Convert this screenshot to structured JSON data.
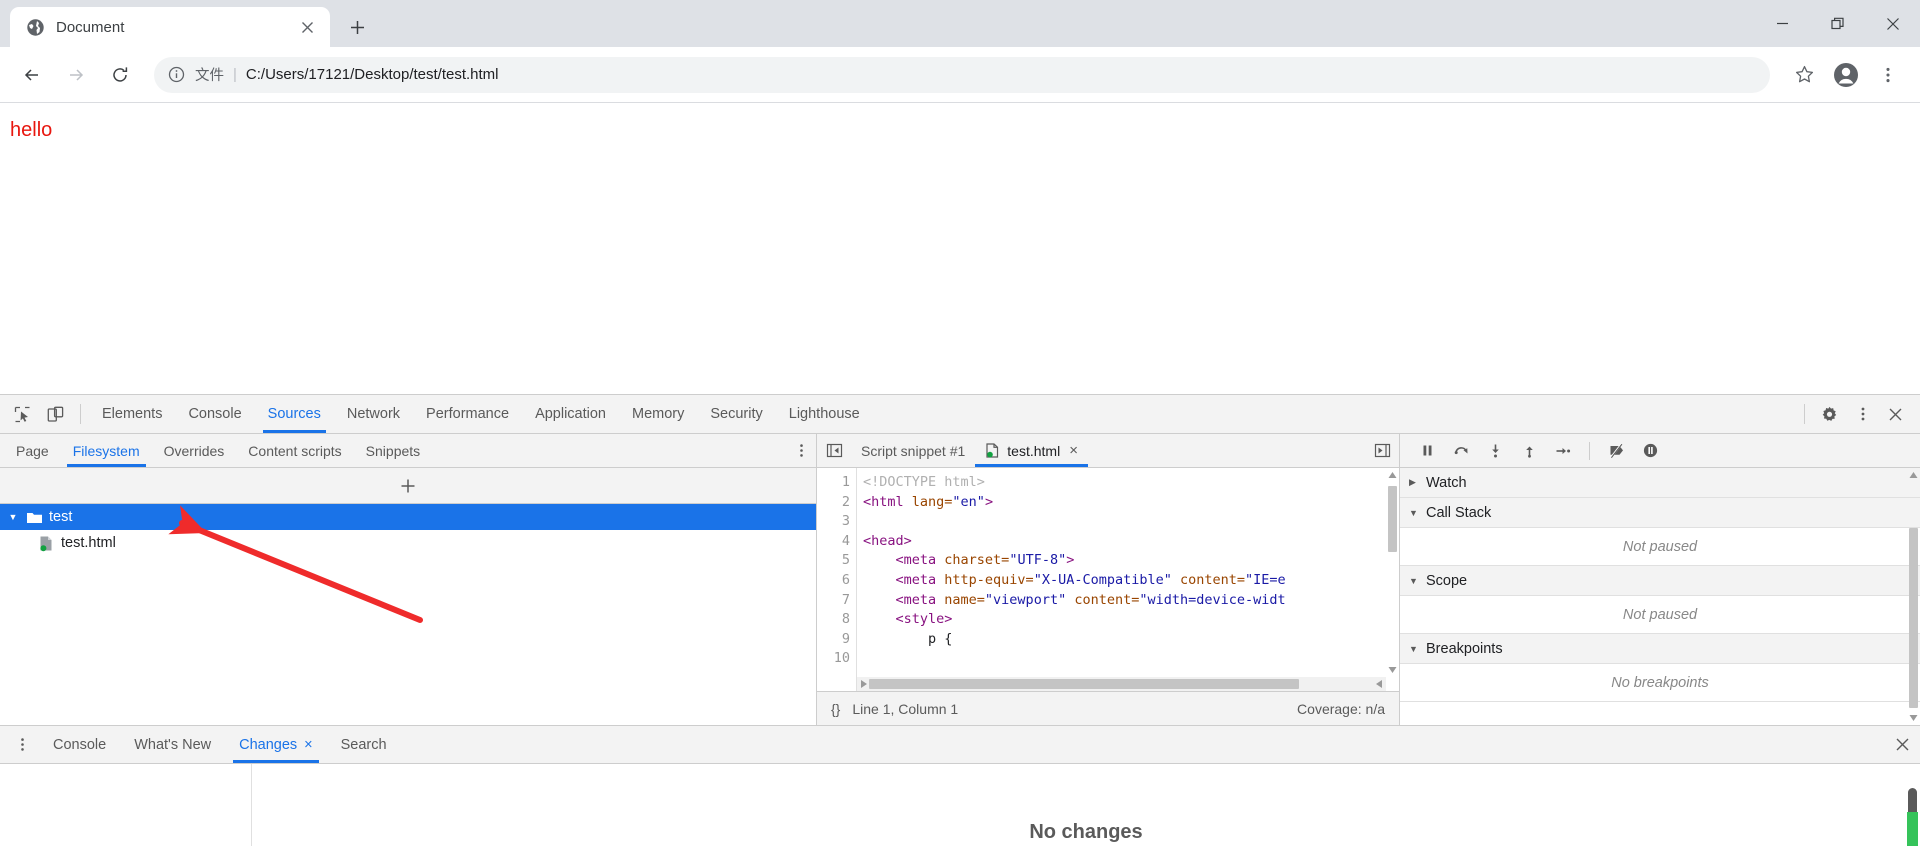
{
  "browser": {
    "tab": {
      "title": "Document",
      "favicon": "globe-icon",
      "close": "×"
    },
    "newtab_label": "+",
    "window_controls": {
      "minimize": "—",
      "restore": "restore-icon",
      "close": "✕"
    },
    "toolbar": {
      "back": "←",
      "forward": "→",
      "reload": "⟳",
      "info_icon": "info-circle-icon",
      "file_label": "文件",
      "separator": "|",
      "url": "C:/Users/17121/Desktop/test/test.html",
      "bookmark": "☆",
      "profile": "avatar-icon",
      "menu": "⋮"
    }
  },
  "page": {
    "text": "hello",
    "color": "#e8170f"
  },
  "devtools": {
    "left_icons": {
      "inspect": "inspect-element-icon",
      "device": "device-toolbar-icon"
    },
    "tabs": [
      {
        "label": "Elements",
        "active": false
      },
      {
        "label": "Console",
        "active": false
      },
      {
        "label": "Sources",
        "active": true
      },
      {
        "label": "Network",
        "active": false
      },
      {
        "label": "Performance",
        "active": false
      },
      {
        "label": "Application",
        "active": false
      },
      {
        "label": "Memory",
        "active": false
      },
      {
        "label": "Security",
        "active": false
      },
      {
        "label": "Lighthouse",
        "active": false
      }
    ],
    "right_icons": {
      "settings": "gear-icon",
      "more": "⋮",
      "close": "✕"
    },
    "accent_color": "#1a73e8",
    "navigator": {
      "subtabs": [
        {
          "label": "Page",
          "active": false
        },
        {
          "label": "Filesystem",
          "active": true
        },
        {
          "label": "Overrides",
          "active": false
        },
        {
          "label": "Content scripts",
          "active": false
        },
        {
          "label": "Snippets",
          "active": false
        }
      ],
      "kebab": "⋮",
      "add_folder_label": "+",
      "tree": [
        {
          "label": "test",
          "type": "folder",
          "selected": true,
          "twisty": "▼",
          "depth": 0
        },
        {
          "label": "test.html",
          "type": "file",
          "selected": false,
          "twisty": "",
          "depth": 1
        }
      ],
      "annotation": {
        "type": "red-arrow",
        "color": "#ef2b2b"
      }
    },
    "editor": {
      "prev_btn": "collapse-left-icon",
      "next_btn": "collapse-right-icon",
      "tabs": [
        {
          "label": "Script snippet #1",
          "active": false,
          "has_icon": false,
          "closable": false
        },
        {
          "label": "test.html",
          "active": true,
          "has_icon": true,
          "closable": true,
          "close": "×"
        }
      ],
      "line_numbers": [
        "1",
        "2",
        "3",
        "4",
        "5",
        "6",
        "7",
        "8",
        "9",
        "10"
      ],
      "lines": [
        [
          {
            "t": "<!DOCTYPE html>",
            "c": "tk-com"
          }
        ],
        [
          {
            "t": "<html ",
            "c": "tk-tag"
          },
          {
            "t": "lang=",
            "c": "tk-att"
          },
          {
            "t": "\"en\"",
            "c": "tk-str"
          },
          {
            "t": ">",
            "c": "tk-tag"
          }
        ],
        [
          {
            "t": "",
            "c": "tk-pln"
          }
        ],
        [
          {
            "t": "<head>",
            "c": "tk-tag"
          }
        ],
        [
          {
            "t": "    <meta ",
            "c": "tk-tag"
          },
          {
            "t": "charset=",
            "c": "tk-att"
          },
          {
            "t": "\"UTF-8\"",
            "c": "tk-str"
          },
          {
            "t": ">",
            "c": "tk-tag"
          }
        ],
        [
          {
            "t": "    <meta ",
            "c": "tk-tag"
          },
          {
            "t": "http-equiv=",
            "c": "tk-att"
          },
          {
            "t": "\"X-UA-Compatible\"",
            "c": "tk-str"
          },
          {
            "t": " content=",
            "c": "tk-att"
          },
          {
            "t": "\"IE=e",
            "c": "tk-str"
          }
        ],
        [
          {
            "t": "    <meta ",
            "c": "tk-tag"
          },
          {
            "t": "name=",
            "c": "tk-att"
          },
          {
            "t": "\"viewport\"",
            "c": "tk-str"
          },
          {
            "t": " content=",
            "c": "tk-att"
          },
          {
            "t": "\"width=device-widt",
            "c": "tk-str"
          }
        ],
        [
          {
            "t": "    <style>",
            "c": "tk-tag"
          }
        ],
        [
          {
            "t": "        p {",
            "c": "tk-pln"
          }
        ],
        [
          {
            "t": "",
            "c": "tk-pln"
          }
        ]
      ],
      "status": {
        "format_icon": "{}",
        "position": "Line 1, Column 1",
        "coverage": "Coverage: n/a"
      }
    },
    "debugger": {
      "controls": [
        {
          "name": "pause-script-execution-icon"
        },
        {
          "name": "step-over-icon"
        },
        {
          "name": "step-into-icon"
        },
        {
          "name": "step-out-icon"
        },
        {
          "name": "step-icon"
        },
        {
          "name": "deactivate-breakpoints-icon"
        },
        {
          "name": "pause-on-exceptions-icon"
        }
      ],
      "sections": [
        {
          "label": "Watch",
          "expanded": false,
          "twisty": "▶",
          "empty": null
        },
        {
          "label": "Call Stack",
          "expanded": true,
          "twisty": "▼",
          "empty": "Not paused"
        },
        {
          "label": "Scope",
          "expanded": true,
          "twisty": "▼",
          "empty": "Not paused"
        },
        {
          "label": "Breakpoints",
          "expanded": true,
          "twisty": "▼",
          "empty": "No breakpoints"
        }
      ]
    },
    "drawer": {
      "kebab": "⋮",
      "tabs": [
        {
          "label": "Console",
          "active": false,
          "closable": false
        },
        {
          "label": "What's New",
          "active": false,
          "closable": false
        },
        {
          "label": "Changes",
          "active": true,
          "closable": true,
          "close": "×"
        },
        {
          "label": "Search",
          "active": false,
          "closable": false
        }
      ],
      "close": "✕",
      "message": "No changes"
    }
  }
}
